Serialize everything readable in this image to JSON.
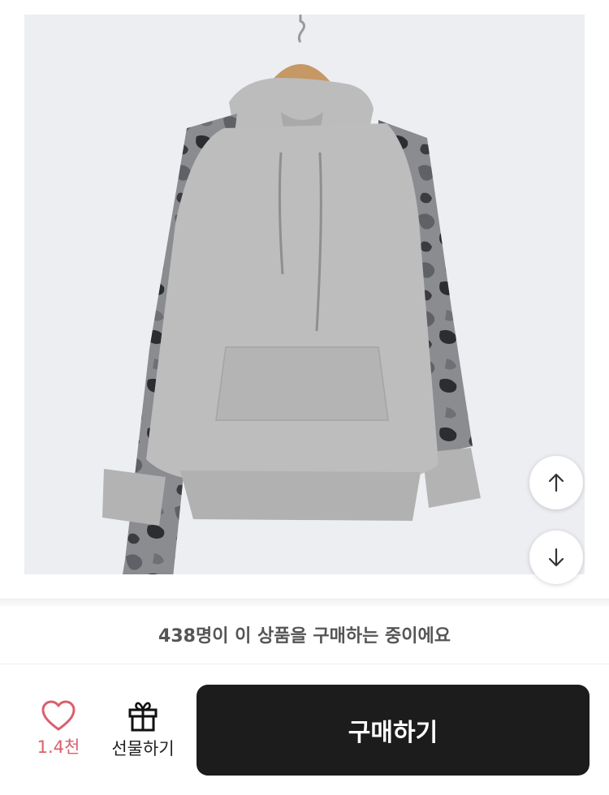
{
  "product": {
    "image_alt": "product-photo-hoodie",
    "body_color": "#b9b9ba",
    "camo_colors": [
      "#5f6166",
      "#8a8c90",
      "#2b2d31"
    ]
  },
  "scroll": {
    "up_icon": "arrow-up-icon",
    "down_icon": "arrow-down-icon"
  },
  "notice": {
    "text": "438명이 이 상품을 구매하는 중이에요"
  },
  "actions": {
    "like_icon": "heart-outline-icon",
    "like_count": "1.4천",
    "like_color": "#d9606c",
    "gift_icon": "gift-icon",
    "gift_label": "선물하기",
    "buy_label": "구매하기",
    "buy_color": "#1c1c1c"
  }
}
